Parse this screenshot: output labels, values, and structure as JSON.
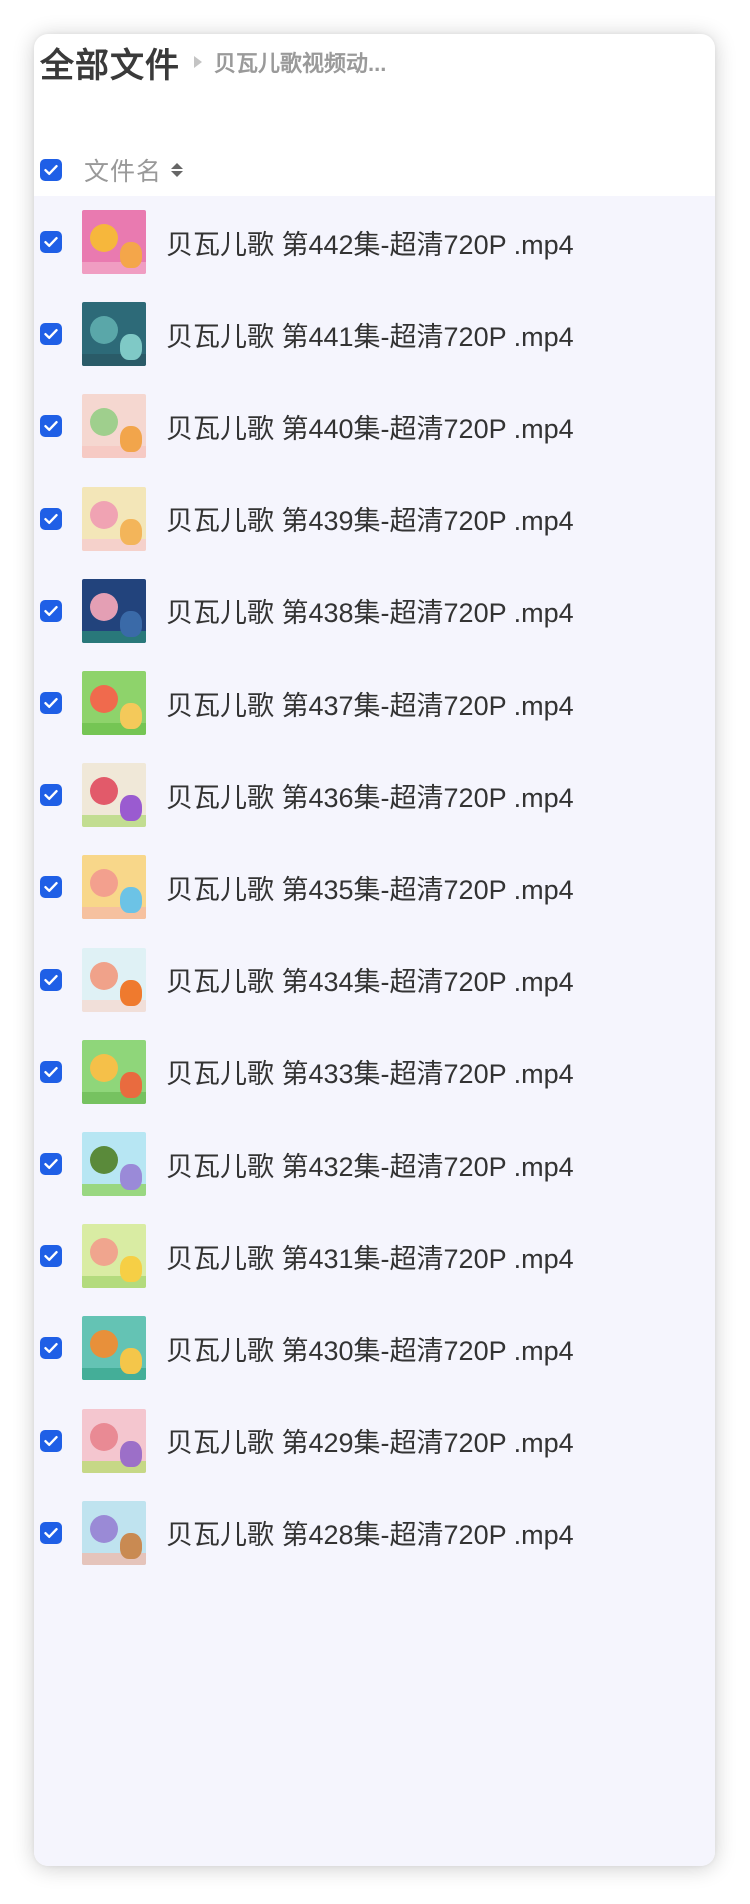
{
  "breadcrumb": {
    "root": "全部文件",
    "current": "贝瓦儿歌视频动..."
  },
  "header": {
    "column_label": "文件名",
    "select_all_checked": true
  },
  "files": [
    {
      "name": "贝瓦儿歌 第442集-超清720P .mp4",
      "checked": true,
      "thumb_colors": [
        "#e97ab0",
        "#f6b73c",
        "#f4a64a",
        "#f2a9c8"
      ]
    },
    {
      "name": "贝瓦儿歌 第441集-超清720P .mp4",
      "checked": true,
      "thumb_colors": [
        "#2d6a78",
        "#5aa7a9",
        "#7fc9c6",
        "#2a5763"
      ]
    },
    {
      "name": "贝瓦儿歌 第440集-超清720P .mp4",
      "checked": true,
      "thumb_colors": [
        "#f5d7d0",
        "#9fcf8d",
        "#f2a54b",
        "#f6c6c0"
      ]
    },
    {
      "name": "贝瓦儿歌 第439集-超清720P .mp4",
      "checked": true,
      "thumb_colors": [
        "#f3e6b8",
        "#f0a3b3",
        "#f3b55a",
        "#f5c9d2"
      ]
    },
    {
      "name": "贝瓦儿歌 第438集-超清720P .mp4",
      "checked": true,
      "thumb_colors": [
        "#22437c",
        "#e49fb4",
        "#3a6aa8",
        "#2c8a7a"
      ]
    },
    {
      "name": "贝瓦儿歌 第437集-超清720P .mp4",
      "checked": true,
      "thumb_colors": [
        "#8ed36b",
        "#f06a4d",
        "#f4c95a",
        "#6cc04c"
      ]
    },
    {
      "name": "贝瓦儿歌 第436集-超清720P .mp4",
      "checked": true,
      "thumb_colors": [
        "#f0e8d8",
        "#e25a6a",
        "#9a5bd0",
        "#b3d97a"
      ]
    },
    {
      "name": "贝瓦儿歌 第435集-超清720P .mp4",
      "checked": true,
      "thumb_colors": [
        "#f8d78a",
        "#f3a08e",
        "#6cc3e6",
        "#f5b9a6"
      ]
    },
    {
      "name": "贝瓦儿歌 第434集-超清720P .mp4",
      "checked": true,
      "thumb_colors": [
        "#dff1f5",
        "#f0a28a",
        "#ef7a2e",
        "#f7d8cf"
      ]
    },
    {
      "name": "贝瓦儿歌 第433集-超清720P .mp4",
      "checked": true,
      "thumb_colors": [
        "#8fd67a",
        "#f5c049",
        "#e96b3f",
        "#6dbb58"
      ]
    },
    {
      "name": "贝瓦儿歌 第432集-超清720P .mp4",
      "checked": true,
      "thumb_colors": [
        "#b7e6f3",
        "#5a8a3a",
        "#9a8ad8",
        "#8fd15b"
      ]
    },
    {
      "name": "贝瓦儿歌 第431集-超清720P .mp4",
      "checked": true,
      "thumb_colors": [
        "#d9eca3",
        "#f0a58e",
        "#f6cf45",
        "#a6d670"
      ]
    },
    {
      "name": "贝瓦儿歌 第430集-超清720P .mp4",
      "checked": true,
      "thumb_colors": [
        "#64c3b4",
        "#e8903a",
        "#f4c64a",
        "#3aa78f"
      ]
    },
    {
      "name": "贝瓦儿歌 第429集-超清720P .mp4",
      "checked": true,
      "thumb_colors": [
        "#f4c6cf",
        "#e98a94",
        "#9c6fc8",
        "#b7dd6e"
      ]
    },
    {
      "name": "贝瓦儿歌 第428集-超清720P .mp4",
      "checked": true,
      "thumb_colors": [
        "#bfe3ef",
        "#9a8ad6",
        "#c98a52",
        "#f1b9a9"
      ]
    }
  ],
  "colors": {
    "accent": "#1f5fe6",
    "list_background": "#f5f5fd",
    "text_primary": "#333333",
    "text_muted": "#999999"
  },
  "icons": {
    "checkbox": "check-icon",
    "sort": "sort-icon",
    "breadcrumb_separator": "caret-right-icon"
  }
}
